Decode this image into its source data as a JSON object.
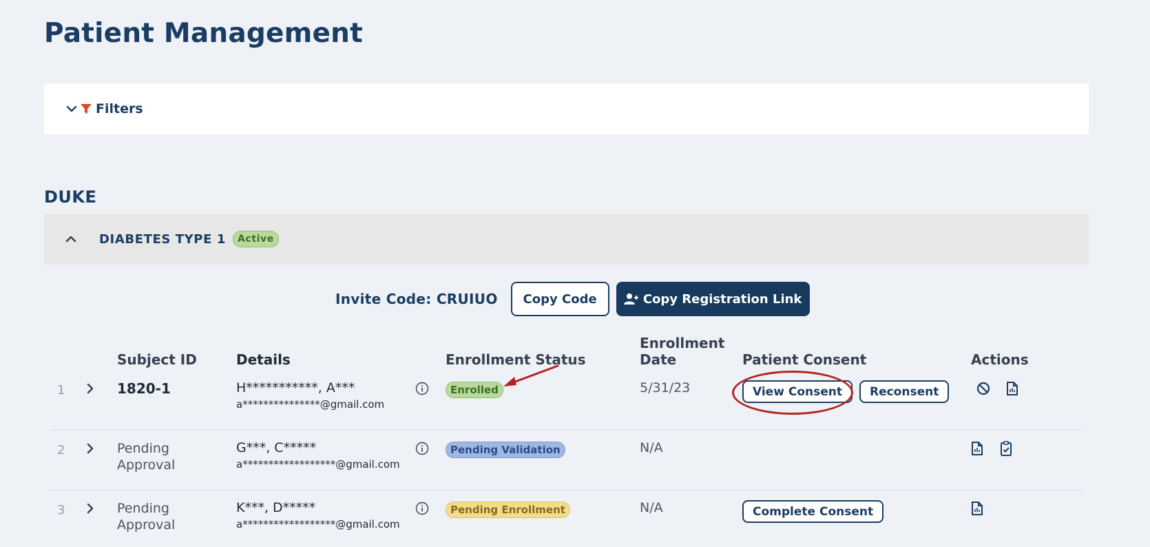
{
  "page": {
    "title": "Patient Management"
  },
  "filters": {
    "label": "Filters"
  },
  "site": {
    "name": "DUKE"
  },
  "study": {
    "name": "DIABETES TYPE 1",
    "status": "Active"
  },
  "invite": {
    "label": "Invite Code: CRUIUO",
    "copy_code": "Copy Code",
    "copy_link": "Copy Registration Link"
  },
  "table": {
    "headers": {
      "subject_id": "Subject ID",
      "details": "Details",
      "enrollment_status": "Enrollment Status",
      "enrollment_date_line1": "Enrollment",
      "enrollment_date_line2": "Date",
      "patient_consent": "Patient Consent",
      "actions": "Actions"
    },
    "rows": [
      {
        "num": "1",
        "subject": "1820-1",
        "name": "H***********, A***",
        "email": "a***************@gmail.com",
        "status": "Enrolled",
        "date": "5/31/23",
        "consent_btn1": "View Consent",
        "consent_btn2": "Reconsent",
        "action_icons": [
          "block-icon",
          "document-icon"
        ]
      },
      {
        "num": "2",
        "subject_line1": "Pending",
        "subject_line2": "Approval",
        "name": "G***, C*****",
        "email": "a******************@gmail.com",
        "status": "Pending Validation",
        "date": "N/A",
        "action_icons": [
          "document-icon",
          "clipboard-check-icon"
        ]
      },
      {
        "num": "3",
        "subject_line1": "Pending",
        "subject_line2": "Approval",
        "name": "K***, D*****",
        "email": "a******************@gmail.com",
        "status": "Pending Enrollment",
        "date": "N/A",
        "consent_btn1": "Complete Consent",
        "action_icons": [
          "document-icon"
        ]
      }
    ]
  },
  "colors": {
    "brand": "#1b3d63",
    "annotation": "#b32525",
    "enrolled": "#b9da9b",
    "pending_validation": "#9fb7e3",
    "pending_enrollment": "#f2dc8e"
  }
}
